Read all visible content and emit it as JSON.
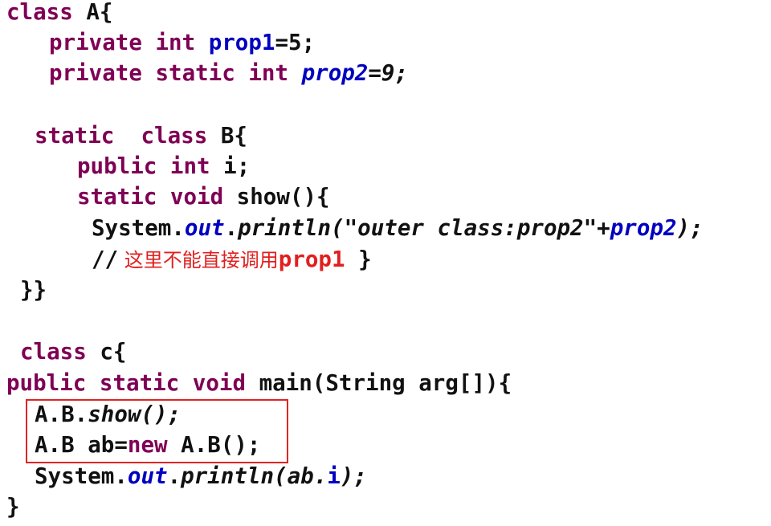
{
  "code": {
    "l1": {
      "kw": "class",
      "rest": " A{"
    },
    "l2": {
      "kw": "private int",
      "sp": " ",
      "field": "prop1",
      "rest": "=5;"
    },
    "l3": {
      "kw": "private static int",
      "sp": " ",
      "field": "prop2",
      "rest": "=9;"
    },
    "l4": {
      "kw1": "static",
      "sp": "  ",
      "kw2": "class",
      "rest": " B{"
    },
    "l5": {
      "kw": "public int",
      "rest": " i;"
    },
    "l6": {
      "kw": "static void",
      "rest": " show(){"
    },
    "l7": {
      "a": "System.",
      "b": "out",
      "c": ".",
      "d": "println(\"outer class:prop2\"+",
      "e": "prop2",
      "f": ");"
    },
    "l8": {
      "slashes": "//",
      "cn": " 这里不能直接调用",
      "prop": "prop1",
      "rest": " }"
    },
    "l9": {
      "text": "}}"
    },
    "l10": {
      "kw": "class",
      "rest": " c{"
    },
    "l11": {
      "kw": "public static void",
      "rest": " main(String arg[]){"
    },
    "l12": {
      "a": "A.B.",
      "b": "show",
      "c": "();"
    },
    "l13": {
      "a": "A.B ab=",
      "kw": "new",
      "b": " A.B();"
    },
    "l14": {
      "a": "System.",
      "b": "out",
      "c": ".",
      "d": "println(ab.",
      "e": "i",
      "f": ");"
    },
    "l15": {
      "text": "}"
    }
  },
  "highlight_color": "#e02424"
}
